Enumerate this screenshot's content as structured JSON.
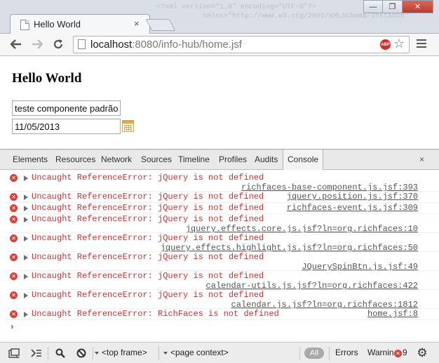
{
  "browser": {
    "tab_title": "Hello World",
    "tab_close": "×",
    "url_host": "localhost",
    "url_rest": ":8080/info-hub/home.jsf",
    "abp_label": "ABP",
    "window_controls": {
      "minimize": "—",
      "maximize": "❐",
      "close": "✕"
    },
    "background_code": "   <?xml version=\"1.0\" encoding=\"UTF-8\"?>\n              xmlns=\"http://www.w3.org/2001/XMLSchema-instance\""
  },
  "page": {
    "title": "Hello World",
    "text_field_value": "teste componente padrão",
    "date_field_value": "11/05/2013"
  },
  "devtools": {
    "tabs": [
      {
        "label": "Elements"
      },
      {
        "label": "Resources"
      },
      {
        "label": "Network"
      },
      {
        "label": "Sources"
      },
      {
        "label": "Timeline"
      },
      {
        "label": "Profiles"
      },
      {
        "label": "Audits"
      },
      {
        "label": "Console",
        "active": true
      }
    ],
    "close": "×",
    "console_messages": [
      {
        "text": "Uncaught ReferenceError: jQuery is not defined",
        "source": "richfaces-base-component.js.jsf:393",
        "wrap": true
      },
      {
        "text": "Uncaught ReferenceError: jQuery is not defined",
        "source": "jquery.position.js.jsf:370",
        "wrap": false
      },
      {
        "text": "Uncaught ReferenceError: jQuery is not defined",
        "source": "richfaces-event.js.jsf:309",
        "wrap": false
      },
      {
        "text": "Uncaught ReferenceError: jQuery is not defined",
        "source": "jquery.effects.core.js.jsf?ln=org.richfaces:10",
        "wrap": true
      },
      {
        "text": "Uncaught ReferenceError: jQuery is not defined",
        "source": "jquery.effects.highlight.js.jsf?ln=org.richfaces:50",
        "wrap": true
      },
      {
        "text": "Uncaught ReferenceError: jQuery is not defined",
        "source": "JQuerySpinBtn.js.jsf:49",
        "wrap": true
      },
      {
        "text": "Uncaught ReferenceError: jQuery is not defined",
        "source": "calendar-utils.js.jsf?ln=org.richfaces:422",
        "wrap": true
      },
      {
        "text": "Uncaught ReferenceError: jQuery is not defined",
        "source": "calendar.js.jsf?ln=org.richfaces:1812",
        "wrap": true
      },
      {
        "text": "Uncaught ReferenceError: RichFaces is not defined",
        "source": "home.jsf:8",
        "wrap": false
      }
    ],
    "prompt": "›",
    "bottom_bar": {
      "frame_select": "<top frame>",
      "context_select": "<page context>",
      "filter_all": "All",
      "filter_errors": "Errors",
      "filter_warnings": "Warnin",
      "error_count": "9"
    }
  },
  "colors": {
    "error_red": "#d03030",
    "error_icon": "#d9403a",
    "prompt_blue": "#2f6fe0"
  },
  "icons": [
    "back-arrow-icon",
    "forward-arrow-icon",
    "reload-icon",
    "page-icon",
    "adblock-icon",
    "star-icon",
    "menu-icon",
    "calendar-icon",
    "error-icon",
    "dock-icon",
    "execute-icon",
    "search-icon",
    "clear-icon",
    "gear-icon"
  ]
}
